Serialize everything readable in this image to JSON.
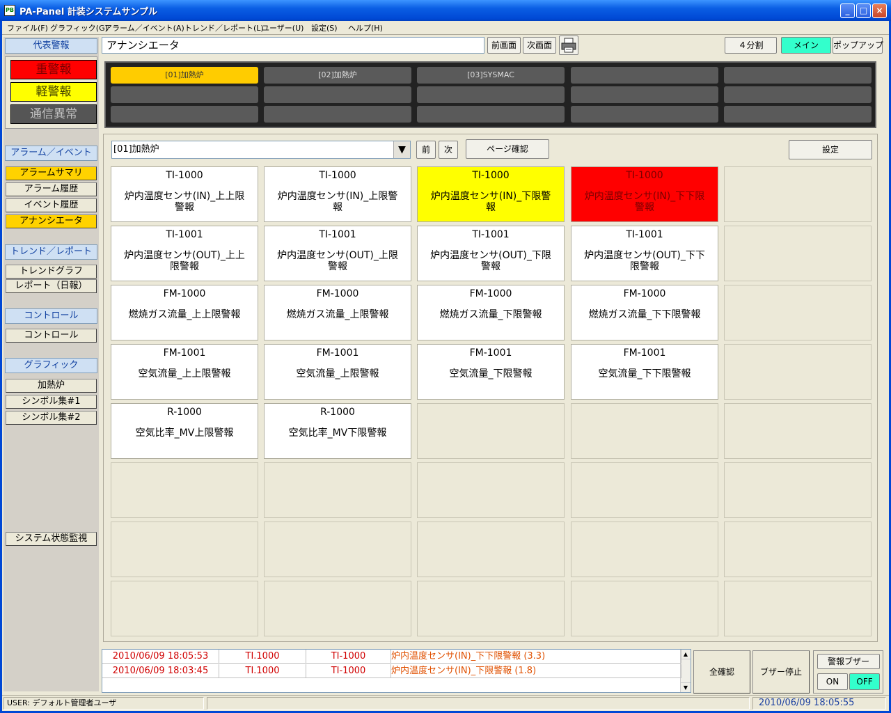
{
  "window": {
    "title": "PA-Panel 計装システムサンプル",
    "icon_label": "PB"
  },
  "menu": [
    "ファイル(F)",
    "グラフィック(G)",
    "アラーム／イベント(A)",
    "トレンド／レポート(L)",
    "ユーザー(U)",
    "設定(S)",
    "ヘルプ(H)"
  ],
  "nav": {
    "rep_alarm_header": "代表警報",
    "rep_alarms": [
      {
        "label": "重警報",
        "bg": "#ff0000",
        "fg": "#7a0000"
      },
      {
        "label": "軽警報",
        "bg": "#ffff00",
        "fg": "#404000"
      },
      {
        "label": "通信異常",
        "bg": "#555555",
        "fg": "#c0c0c0"
      }
    ],
    "alarm_event_header": "アラーム／イベント",
    "alarm_items": [
      {
        "label": "アラームサマリ",
        "active": true
      },
      {
        "label": "アラーム履歴",
        "active": false
      },
      {
        "label": "イベント履歴",
        "active": false
      },
      {
        "label": "アナンシエータ",
        "active": true
      }
    ],
    "trend_header": "トレンド／レポート",
    "trend_items": [
      "トレンドグラフ",
      "レポート（日報）"
    ],
    "control_header": "コントロール",
    "control_items": [
      "コントロール"
    ],
    "graphic_header": "グラフィック",
    "graphic_items": [
      "加熱炉",
      "シンボル集#1",
      "シンボル集#2"
    ],
    "system_monitor": "システム状態監視"
  },
  "toolbar": {
    "screen_title": "アナンシエータ",
    "prev_screen": "前画面",
    "next_screen": "次画面",
    "printer_icon": "printer-icon",
    "split4": "４分割",
    "main": "メイン",
    "popup": "ポップアップ",
    "main_color": "#33ffcc"
  },
  "tag_groups": [
    "[01]加熱炉",
    "[02]加熱炉",
    "[03]SYSMAC",
    "",
    "",
    "",
    "",
    "",
    "",
    "",
    "",
    "",
    "",
    "",
    ""
  ],
  "group_select": {
    "value": "[01]加熱炉",
    "prev": "前",
    "next": "次",
    "page_confirm": "ページ確認",
    "settings": "設定"
  },
  "tiles": [
    {
      "tag": "TI-1000",
      "desc": "炉内温度センサ(IN)_上上限警報",
      "state": "normal"
    },
    {
      "tag": "TI-1000",
      "desc": "炉内温度センサ(IN)_上限警報",
      "state": "normal"
    },
    {
      "tag": "TI-1000",
      "desc": "炉内温度センサ(IN)_下限警報",
      "state": "yellow"
    },
    {
      "tag": "TI-1000",
      "desc": "炉内温度センサ(IN)_下下限警報",
      "state": "red"
    },
    {
      "tag": "",
      "desc": "",
      "state": "empty"
    },
    {
      "tag": "TI-1001",
      "desc": "炉内温度センサ(OUT)_上上限警報",
      "state": "normal"
    },
    {
      "tag": "TI-1001",
      "desc": "炉内温度センサ(OUT)_上限警報",
      "state": "normal"
    },
    {
      "tag": "TI-1001",
      "desc": "炉内温度センサ(OUT)_下限警報",
      "state": "normal"
    },
    {
      "tag": "TI-1001",
      "desc": "炉内温度センサ(OUT)_下下限警報",
      "state": "normal"
    },
    {
      "tag": "",
      "desc": "",
      "state": "empty"
    },
    {
      "tag": "FM-1000",
      "desc": "燃焼ガス流量_上上限警報",
      "state": "normal"
    },
    {
      "tag": "FM-1000",
      "desc": "燃焼ガス流量_上限警報",
      "state": "normal"
    },
    {
      "tag": "FM-1000",
      "desc": "燃焼ガス流量_下限警報",
      "state": "normal"
    },
    {
      "tag": "FM-1000",
      "desc": "燃焼ガス流量_下下限警報",
      "state": "normal"
    },
    {
      "tag": "",
      "desc": "",
      "state": "empty"
    },
    {
      "tag": "FM-1001",
      "desc": "空気流量_上上限警報",
      "state": "normal"
    },
    {
      "tag": "FM-1001",
      "desc": "空気流量_上限警報",
      "state": "normal"
    },
    {
      "tag": "FM-1001",
      "desc": "空気流量_下限警報",
      "state": "normal"
    },
    {
      "tag": "FM-1001",
      "desc": "空気流量_下下限警報",
      "state": "normal"
    },
    {
      "tag": "",
      "desc": "",
      "state": "empty"
    },
    {
      "tag": "R-1000",
      "desc": "空気比率_MV上限警報",
      "state": "normal"
    },
    {
      "tag": "R-1000",
      "desc": "空気比率_MV下限警報",
      "state": "normal"
    },
    {
      "tag": "",
      "desc": "",
      "state": "empty"
    },
    {
      "tag": "",
      "desc": "",
      "state": "empty"
    },
    {
      "tag": "",
      "desc": "",
      "state": "empty"
    },
    {
      "tag": "",
      "desc": "",
      "state": "empty"
    },
    {
      "tag": "",
      "desc": "",
      "state": "empty"
    },
    {
      "tag": "",
      "desc": "",
      "state": "empty"
    },
    {
      "tag": "",
      "desc": "",
      "state": "empty"
    },
    {
      "tag": "",
      "desc": "",
      "state": "empty"
    },
    {
      "tag": "",
      "desc": "",
      "state": "empty"
    },
    {
      "tag": "",
      "desc": "",
      "state": "empty"
    },
    {
      "tag": "",
      "desc": "",
      "state": "empty"
    },
    {
      "tag": "",
      "desc": "",
      "state": "empty"
    },
    {
      "tag": "",
      "desc": "",
      "state": "empty"
    },
    {
      "tag": "",
      "desc": "",
      "state": "empty"
    },
    {
      "tag": "",
      "desc": "",
      "state": "empty"
    },
    {
      "tag": "",
      "desc": "",
      "state": "empty"
    },
    {
      "tag": "",
      "desc": "",
      "state": "empty"
    },
    {
      "tag": "",
      "desc": "",
      "state": "empty"
    }
  ],
  "log": [
    {
      "time": "2010/06/09 18:05:53",
      "station": "TI.1000",
      "tag": "TI-1000",
      "message": "炉内温度センサ(IN)_下下限警報 (3.3)"
    },
    {
      "time": "2010/06/09 18:03:45",
      "station": "TI.1000",
      "tag": "TI-1000",
      "message": "炉内温度センサ(IN)_下限警報 (1.8)"
    }
  ],
  "bottom_buttons": {
    "ack_all": "全確認",
    "buzzer_stop": "ブザー停止",
    "buzzer_label": "警報ブザー",
    "on": "ON",
    "off": "OFF"
  },
  "status": {
    "user": "USER: デフォルト管理者ユーザ",
    "datetime": "2010/06/09 18:05:55"
  }
}
